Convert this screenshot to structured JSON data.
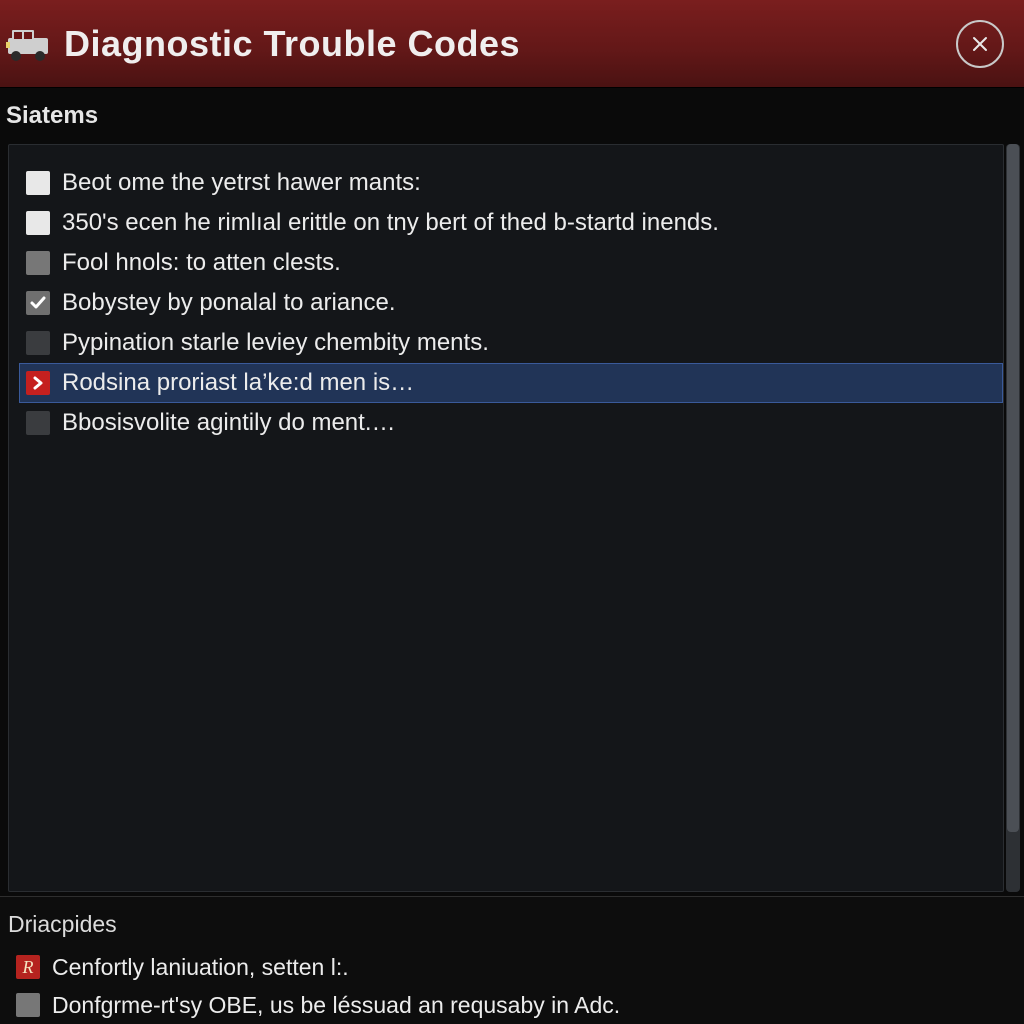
{
  "header": {
    "title": "Diagnostic Trouble Codes"
  },
  "section_label": "Siatems",
  "items": [
    {
      "icon": "box-white",
      "label": "Beot ome the yetrst hawer mants:"
    },
    {
      "icon": "box-white",
      "label": "350's ecen he rimlıal erittle on tny bert of thed b-startd inends."
    },
    {
      "icon": "box-grey",
      "label": "Fool hnols: to atten clests."
    },
    {
      "icon": "box-check",
      "label": "Bobystey by ponalal to ariance."
    },
    {
      "icon": "box-dim",
      "label": "Pypination starle leviey chembity ments."
    },
    {
      "icon": "box-red",
      "label": "Rodsina proriast la’ke:d men is…",
      "selected": true
    },
    {
      "icon": "box-dim",
      "label": "Bbosisvolite agintily do ment.…"
    }
  ],
  "bottom_label": "Driacpides",
  "bottom_items": [
    {
      "icon": "box-red-alt",
      "glyph": "R",
      "label": "Cenfortly laniuation, setten l:."
    },
    {
      "icon": "box-grey",
      "label": "Donfgrme-rt'sy OBE, us be léssuad an requsaby in Adc."
    }
  ]
}
